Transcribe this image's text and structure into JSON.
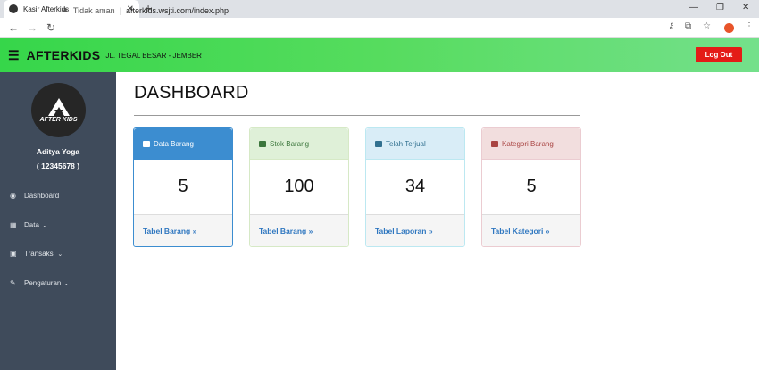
{
  "browser": {
    "tab_title": "Kasir Afterkids",
    "security_label": "Tidak aman",
    "url": "afterkids.wsjti.com/index.php"
  },
  "header": {
    "brand": "AFTERKIDS",
    "address": "JL. TEGAL BESAR - JEMBER",
    "logout_label": "Log Out"
  },
  "sidebar": {
    "logo_text": "AFTER KIDS",
    "user_name": "Aditya Yoga",
    "user_id": "( 12345678 )",
    "items": [
      {
        "label": "Dashboard",
        "icon": "dashboard-icon",
        "has_caret": false
      },
      {
        "label": "Data",
        "icon": "database-icon",
        "has_caret": true
      },
      {
        "label": "Transaksi",
        "icon": "money-icon",
        "has_caret": true
      },
      {
        "label": "Pengaturan",
        "icon": "edit-icon",
        "has_caret": true
      }
    ]
  },
  "main": {
    "title": "DASHBOARD",
    "cards": [
      {
        "title": "Data Barang",
        "value": "5",
        "link": "Tabel Barang",
        "head_bg": "#3c8dd0",
        "head_color": "#ffffff",
        "border": "#3c8dd0"
      },
      {
        "title": "Stok Barang",
        "value": "100",
        "link": "Tabel Barang",
        "head_bg": "#dff0d8",
        "head_color": "#3c763d",
        "border": "#d6e9c6"
      },
      {
        "title": "Telah Terjual",
        "value": "34",
        "link": "Tabel Laporan",
        "head_bg": "#d9edf7",
        "head_color": "#31708f",
        "border": "#bce8f1"
      },
      {
        "title": "Kategori Barang",
        "value": "5",
        "link": "Tabel Kategori",
        "head_bg": "#f2dede",
        "head_color": "#a94442",
        "border": "#ebccd1"
      }
    ]
  }
}
